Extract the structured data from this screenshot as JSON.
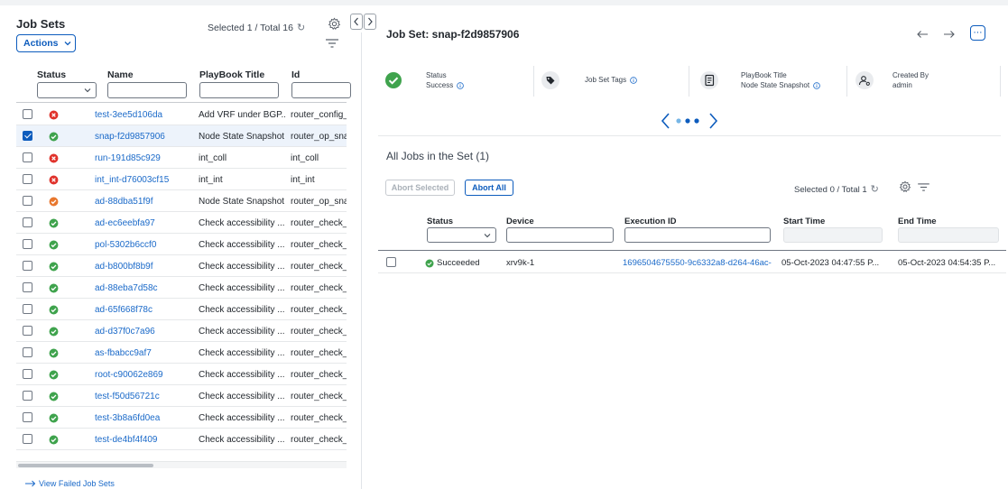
{
  "left_panel": {
    "title": "Job Sets",
    "selection_status": "Selected 1 / Total 16",
    "actions_label": "Actions",
    "columns": [
      "Status",
      "Name",
      "PlayBook Title",
      "Id"
    ],
    "rows": [
      {
        "status": "error",
        "name": "test-3ee5d106da",
        "playbook": "Add VRF under BGP...",
        "id": "router_config_",
        "selected": false
      },
      {
        "status": "success",
        "name": "snap-f2d9857906",
        "playbook": "Node State Snapshot",
        "id": "router_op_snap",
        "selected": true
      },
      {
        "status": "error",
        "name": "run-191d85c929",
        "playbook": "int_coll",
        "id": "int_coll",
        "selected": false
      },
      {
        "status": "error",
        "name": "int_int-d76003cf15",
        "playbook": "int_int",
        "id": "int_int",
        "selected": false
      },
      {
        "status": "warning",
        "name": "ad-88dba51f9f",
        "playbook": "Node State Snapshot",
        "id": "router_op_snap",
        "selected": false
      },
      {
        "status": "success",
        "name": "ad-ec6eebfa97",
        "playbook": "Check accessibility ...",
        "id": "router_check_a",
        "selected": false
      },
      {
        "status": "success",
        "name": "pol-5302b6ccf0",
        "playbook": "Check accessibility ...",
        "id": "router_check_a",
        "selected": false
      },
      {
        "status": "success",
        "name": "ad-b800bf8b9f",
        "playbook": "Check accessibility ...",
        "id": "router_check_a",
        "selected": false
      },
      {
        "status": "success",
        "name": "ad-88eba7d58c",
        "playbook": "Check accessibility ...",
        "id": "router_check_a",
        "selected": false
      },
      {
        "status": "success",
        "name": "ad-65f668f78c",
        "playbook": "Check accessibility ...",
        "id": "router_check_a",
        "selected": false
      },
      {
        "status": "success",
        "name": "ad-d37f0c7a96",
        "playbook": "Check accessibility ...",
        "id": "router_check_a",
        "selected": false
      },
      {
        "status": "success",
        "name": "as-fbabcc9af7",
        "playbook": "Check accessibility ...",
        "id": "router_check_a",
        "selected": false
      },
      {
        "status": "success",
        "name": "root-c90062e869",
        "playbook": "Check accessibility ...",
        "id": "router_check_a",
        "selected": false
      },
      {
        "status": "success",
        "name": "test-f50d56721c",
        "playbook": "Check accessibility ...",
        "id": "router_check_a",
        "selected": false
      },
      {
        "status": "success",
        "name": "test-3b8a6fd0ea",
        "playbook": "Check accessibility ...",
        "id": "router_check_a",
        "selected": false
      },
      {
        "status": "success",
        "name": "test-de4bf4f409",
        "playbook": "Check accessibility ...",
        "id": "router_check_a",
        "selected": false
      }
    ],
    "view_failed_label": "View Failed Job Sets"
  },
  "right_panel": {
    "title": "Job Set: snap-f2d9857906",
    "summary": {
      "status_label": "Status",
      "status_value": "Success",
      "tags_label": "Job Set Tags",
      "playbook_label": "PlayBook Title",
      "playbook_value": "Node State Snapshot",
      "created_label": "Created By",
      "created_value": "admin"
    },
    "jobs_title": "All Jobs in the Set (1)",
    "abort_selected_label": "Abort Selected",
    "abort_all_label": "Abort All",
    "selection_status": "Selected 0 / Total 1",
    "columns": [
      "Status",
      "Device",
      "Execution ID",
      "Start Time",
      "End Time"
    ],
    "rows": [
      {
        "status": "Succeeded",
        "device": "xrv9k-1",
        "execution_id": "1696504675550-9c6332a8-d264-46ac-",
        "start_time": "05-Oct-2023 04:47:55 P...",
        "end_time": "05-Oct-2023 04:54:35 P..."
      }
    ]
  },
  "colors": {
    "success": "#3fa34d",
    "error": "#e0322b",
    "warning": "#e8772e",
    "link": "#1b6ac9",
    "primary": "#0d5cbd",
    "selected_row": "#edf3fb"
  },
  "icons": {
    "status_success": "check-circle-icon",
    "status_error": "x-circle-icon",
    "status_warning": "check-circle-orange-icon",
    "refresh": "refresh-icon",
    "settings": "gear-icon",
    "filter": "filter-icon",
    "tags": "tag-icon",
    "playbook": "notebook-icon",
    "created_by": "user-gear-icon",
    "info": "info-icon"
  }
}
